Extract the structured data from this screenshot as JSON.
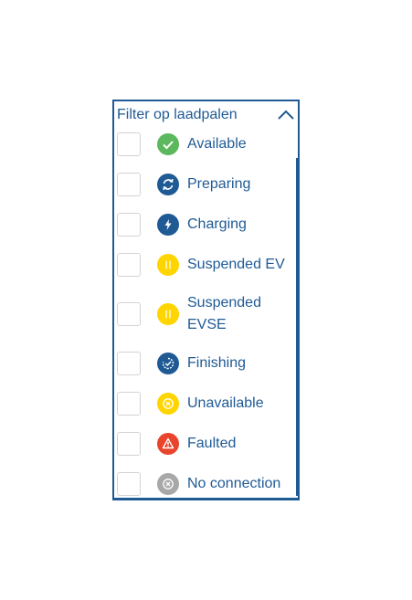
{
  "filter": {
    "title": "Filter op laadpalen",
    "items": [
      {
        "label": "Available",
        "icon": "check-icon",
        "color": "#5cb85c"
      },
      {
        "label": "Preparing",
        "icon": "refresh-icon",
        "color": "#1f5a94"
      },
      {
        "label": "Charging",
        "icon": "lightning-icon",
        "color": "#1f5a94"
      },
      {
        "label": "Suspended EV",
        "icon": "pause-icon",
        "color": "#ffd500"
      },
      {
        "label_line1": "Suspended",
        "label_line2": "EVSE",
        "icon": "pause-icon",
        "color": "#ffd500"
      },
      {
        "label": "Finishing",
        "icon": "finishing-icon",
        "color": "#1f5a94"
      },
      {
        "label": "Unavailable",
        "icon": "unavailable-icon",
        "color": "#ffd500"
      },
      {
        "label": "Faulted",
        "icon": "warning-icon",
        "color": "#e8452c"
      },
      {
        "label": "No connection",
        "icon": "no-connection-icon",
        "color": "#a8a8a8"
      }
    ]
  }
}
